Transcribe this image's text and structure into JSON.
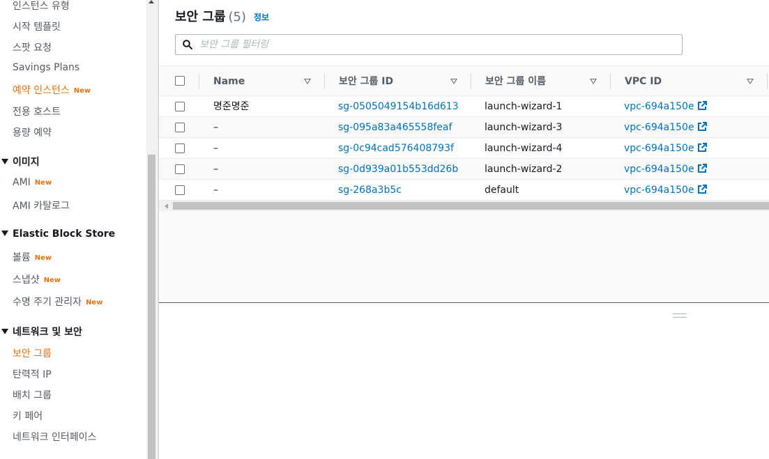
{
  "sidebar": {
    "items_top": [
      {
        "label": "인스턴스 유형",
        "badge": ""
      },
      {
        "label": "시작 템플릿",
        "badge": ""
      },
      {
        "label": "스팟 요청",
        "badge": ""
      },
      {
        "label": "Savings Plans",
        "badge": ""
      },
      {
        "label": "예약 인스턴스",
        "badge": "New"
      },
      {
        "label": "전용 호스트",
        "badge": ""
      },
      {
        "label": "용량 예약",
        "badge": ""
      }
    ],
    "sections": [
      {
        "title": "이미지",
        "items": [
          {
            "label": "AMI",
            "badge": "New"
          },
          {
            "label": "AMI 카탈로그",
            "badge": ""
          }
        ]
      },
      {
        "title": "Elastic Block Store",
        "items": [
          {
            "label": "볼륨",
            "badge": "New"
          },
          {
            "label": "스냅샷",
            "badge": "New"
          },
          {
            "label": "수명 주기 관리자",
            "badge": "New"
          }
        ]
      },
      {
        "title": "네트워크 및 보안",
        "items": [
          {
            "label": "보안 그룹",
            "badge": ""
          },
          {
            "label": "탄력적 IP",
            "badge": ""
          },
          {
            "label": "배치 그룹",
            "badge": ""
          },
          {
            "label": "키 페어",
            "badge": ""
          },
          {
            "label": "네트워크 인터페이스",
            "badge": ""
          }
        ]
      }
    ]
  },
  "header": {
    "title": "보안 그룹",
    "count": "(5)",
    "info_link": "정보"
  },
  "search": {
    "placeholder": "보안 그룹 필터링",
    "value": ""
  },
  "table": {
    "columns": [
      "Name",
      "보안 그룹 ID",
      "보안 그룹 이름",
      "VPC ID"
    ],
    "rows": [
      {
        "name": "명준명준",
        "sg_id": "sg-0505049154b16d613",
        "sg_name": "launch-wizard-1",
        "vpc_id": "vpc-694a150e"
      },
      {
        "name": "–",
        "sg_id": "sg-095a83a465558feaf",
        "sg_name": "launch-wizard-3",
        "vpc_id": "vpc-694a150e"
      },
      {
        "name": "–",
        "sg_id": "sg-0c94cad576408793f",
        "sg_name": "launch-wizard-4",
        "vpc_id": "vpc-694a150e"
      },
      {
        "name": "–",
        "sg_id": "sg-0d939a01b553dd26b",
        "sg_name": "launch-wizard-2",
        "vpc_id": "vpc-694a150e"
      },
      {
        "name": "–",
        "sg_id": "sg-268a3b5c",
        "sg_name": "default",
        "vpc_id": "vpc-694a150e"
      }
    ]
  },
  "icons": {
    "search": "search-icon",
    "external_link": "external-link-icon",
    "sort": "sort-caret-icon",
    "section_caret": "caret-down-icon"
  },
  "colors": {
    "accent_orange": "#ec7211",
    "link_blue": "#0073bb"
  }
}
